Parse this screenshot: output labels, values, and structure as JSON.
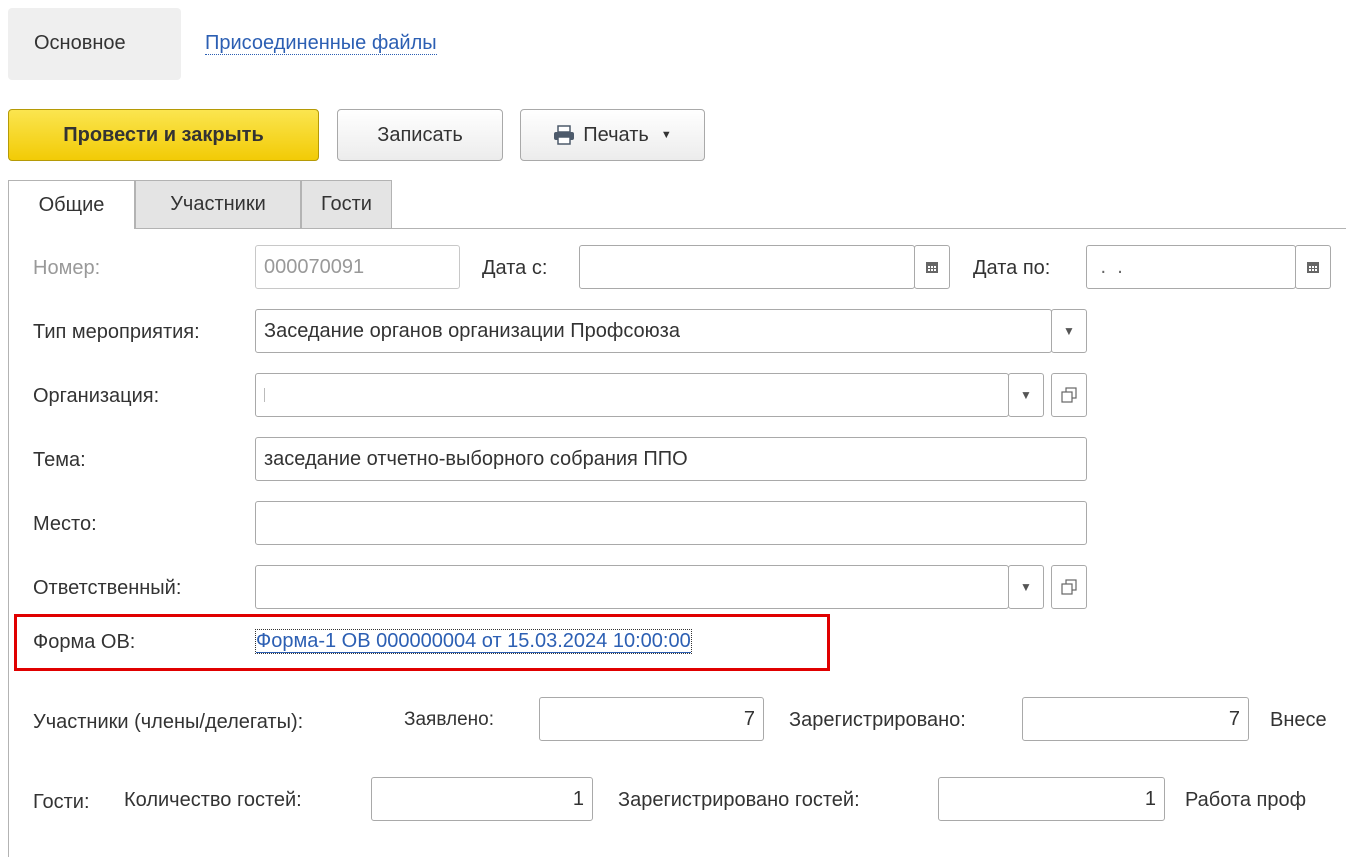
{
  "nav": {
    "main": "Основное",
    "attached_files": "Присоединенные файлы"
  },
  "toolbar": {
    "post_close": "Провести и закрыть",
    "save": "Записать",
    "print": "Печать"
  },
  "tabs": [
    "Общие",
    "Участники",
    "Гости"
  ],
  "fields": {
    "number_label": "Номер:",
    "number_value": "000070091",
    "date_from_label": "Дата с:",
    "date_from_value": "",
    "date_to_label": "Дата по:",
    "date_to_value": " .  .",
    "event_type_label": "Тип мероприятия:",
    "event_type_value": "Заседание органов организации Профсоюза",
    "organization_label": "Организация:",
    "organization_value": "",
    "topic_label": "Тема:",
    "topic_value": "заседание отчетно-выборного собрания ППО",
    "place_label": "Место:",
    "place_value": "",
    "responsible_label": "Ответственный:",
    "responsible_value": "",
    "form_ov_label": "Форма ОВ:",
    "form_ov_link": "Форма-1 ОВ 000000004 от 15.03.2024 10:00:00"
  },
  "participants": {
    "label": "Участники (члены/делегаты):",
    "declared_label": "Заявлено:",
    "declared_value": "7",
    "registered_label": "Зарегистрировано:",
    "registered_value": "7",
    "added_label": "Внесе"
  },
  "guests": {
    "label": "Гости:",
    "count_label": "Количество гостей:",
    "count_value": "1",
    "registered_label": "Зарегистрировано гостей:",
    "registered_value": "1",
    "work_label": "Работа проф"
  },
  "icons": {
    "print": "printer-icon",
    "calendar": "calendar-icon",
    "dropdown": "chevron-down-icon",
    "open": "open-form-icon"
  },
  "colors": {
    "primary_button": "#f2cb06",
    "link": "#2c5fb3",
    "highlight": "#e00000"
  }
}
